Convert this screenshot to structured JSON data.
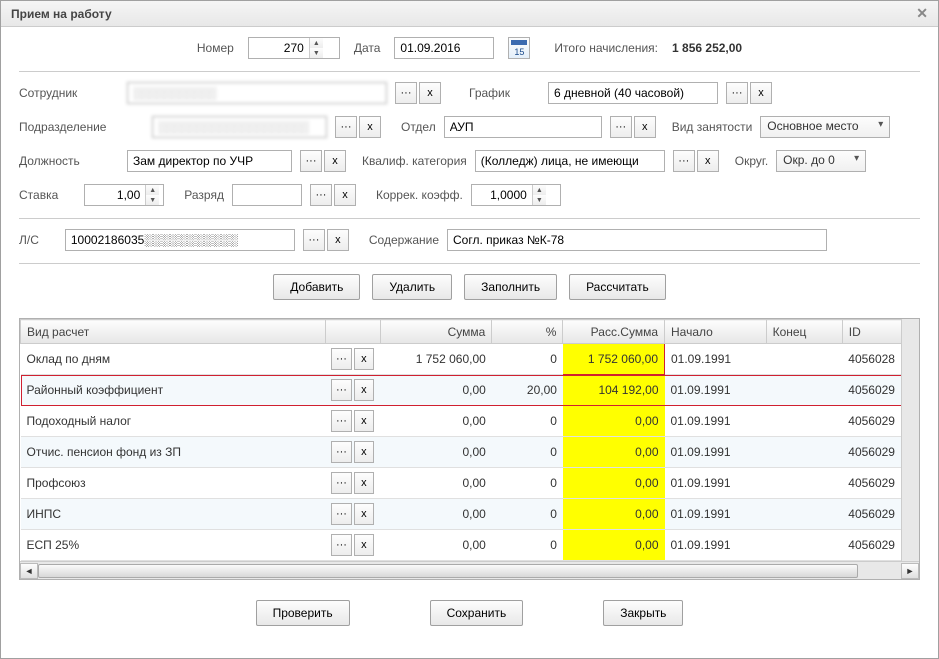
{
  "window": {
    "title": "Прием на работу"
  },
  "header": {
    "number_label": "Номер",
    "number_value": "270",
    "date_label": "Дата",
    "date_value": "01.09.2016",
    "total_label": "Итого начисления:",
    "total_value": "1 856 252,00"
  },
  "fields": {
    "employee_label": "Сотрудник",
    "employee_value": "░░░░░░░░░░░",
    "schedule_label": "График",
    "schedule_value": "6 дневной (40 часовой)",
    "dept_label": "Подразделение",
    "dept_value": "░░░░░░░░░░░░░░░░░░░░",
    "section_label": "Отдел",
    "section_value": "АУП",
    "emptype_label": "Вид занятости",
    "emptype_value": "Основное место",
    "position_label": "Должность",
    "position_value": "Зам директор по УЧР",
    "qualcat_label": "Квалиф. категория",
    "qualcat_value": "(Колледж) лица, не имеющи",
    "round_label": "Округ.",
    "round_value": "Окр. до 0",
    "rate_label": "Ставка",
    "rate_value": "1,00",
    "grade_label": "Разряд",
    "grade_value": "",
    "coeff_label": "Коррек. коэфф.",
    "coeff_value": "1,0000",
    "account_label": "Л/С",
    "account_value": "10002186035░░░░░░░░░░░",
    "content_label": "Содержание",
    "content_value": "Согл. приказ №К-78"
  },
  "toolbar": {
    "add": "Добавить",
    "delete": "Удалить",
    "fill": "Заполнить",
    "calc": "Рассчитать"
  },
  "table": {
    "headers": {
      "type": "Вид расчет",
      "sum": "Сумма",
      "pct": "%",
      "calc": "Расс.Сумма",
      "start": "Начало",
      "end": "Конец",
      "id": "ID"
    },
    "rows": [
      {
        "name": "Оклад по дням",
        "sum": "1 752 060,00",
        "pct": "0",
        "calc": "1 752 060,00",
        "start": "01.09.1991",
        "end": "",
        "id": "4056028",
        "hlrow": true
      },
      {
        "name": "Районный коэффициент",
        "sum": "0,00",
        "pct": "20,00",
        "calc": "104 192,00",
        "start": "01.09.1991",
        "end": "",
        "id": "4056029",
        "hlrow": true
      },
      {
        "name": "Подоходный налог",
        "sum": "0,00",
        "pct": "0",
        "calc": "0,00",
        "start": "01.09.1991",
        "end": "",
        "id": "4056029"
      },
      {
        "name": "Отчис. пенсион фонд из ЗП",
        "sum": "0,00",
        "pct": "0",
        "calc": "0,00",
        "start": "01.09.1991",
        "end": "",
        "id": "4056029"
      },
      {
        "name": "Профсоюз",
        "sum": "0,00",
        "pct": "0",
        "calc": "0,00",
        "start": "01.09.1991",
        "end": "",
        "id": "4056029"
      },
      {
        "name": "ИНПС",
        "sum": "0,00",
        "pct": "0",
        "calc": "0,00",
        "start": "01.09.1991",
        "end": "",
        "id": "4056029"
      },
      {
        "name": "ЕСП 25%",
        "sum": "0,00",
        "pct": "0",
        "calc": "0,00",
        "start": "01.09.1991",
        "end": "",
        "id": "4056029"
      }
    ]
  },
  "footer": {
    "check": "Проверить",
    "save": "Сохранить",
    "close": "Закрыть"
  }
}
